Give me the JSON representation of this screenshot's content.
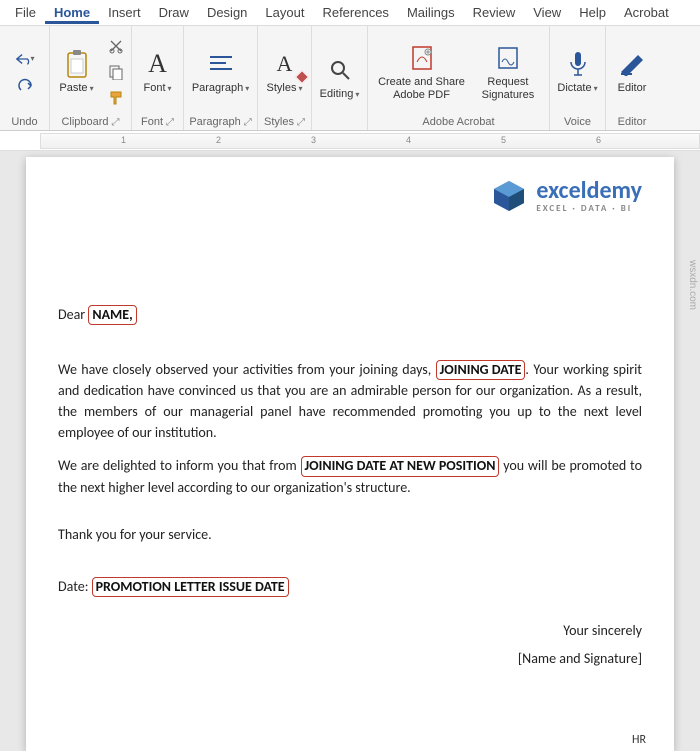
{
  "menu": {
    "items": [
      "File",
      "Home",
      "Insert",
      "Draw",
      "Design",
      "Layout",
      "References",
      "Mailings",
      "Review",
      "View",
      "Help",
      "Acrobat"
    ],
    "active": "Home"
  },
  "ribbon": {
    "undo": {
      "label": "Undo"
    },
    "clipboard": {
      "paste": "Paste",
      "label": "Clipboard"
    },
    "font": {
      "btn": "Font",
      "label": "Font"
    },
    "paragraph": {
      "btn": "Paragraph",
      "label": "Paragraph"
    },
    "styles": {
      "btn": "Styles",
      "label": "Styles"
    },
    "editing": {
      "btn": "Editing"
    },
    "adobe": {
      "create": "Create and Share\nAdobe PDF",
      "request": "Request\nSignatures",
      "label": "Adobe Acrobat"
    },
    "voice": {
      "dictate": "Dictate",
      "label": "Voice"
    },
    "editor": {
      "btn": "Editor",
      "label": "Editor"
    }
  },
  "ruler": {
    "marks": [
      "1",
      "2",
      "3",
      "4",
      "5",
      "6"
    ]
  },
  "logo": {
    "main": "exceldemy",
    "sub": "EXCEL · DATA · BI"
  },
  "doc": {
    "dear": "Dear ",
    "name_ph": "NAME,",
    "p1a": "We have closely observed your activities from your joining days, ",
    "join_ph": "JOINING DATE",
    "p1b": ". Your working spirit and dedication have convinced us that you are an admirable person for our organization. As a result, the members of our managerial panel have recommended promoting you up to the next level employee of our institution.",
    "p2a": "We are delighted to inform you that from ",
    "newpos_ph": "JOINING DATE AT NEW POSITION",
    "p2b": " you will be promoted to the next higher level according to our organization's structure.",
    "thanks": "Thank you for your service.",
    "date_label": "Date: ",
    "issue_ph": "PROMOTION LETTER ISSUE DATE",
    "closing": "Your sincerely",
    "sig": "[Name and Signature]",
    "hr": "HR"
  },
  "watermark": "wsxdn.com"
}
